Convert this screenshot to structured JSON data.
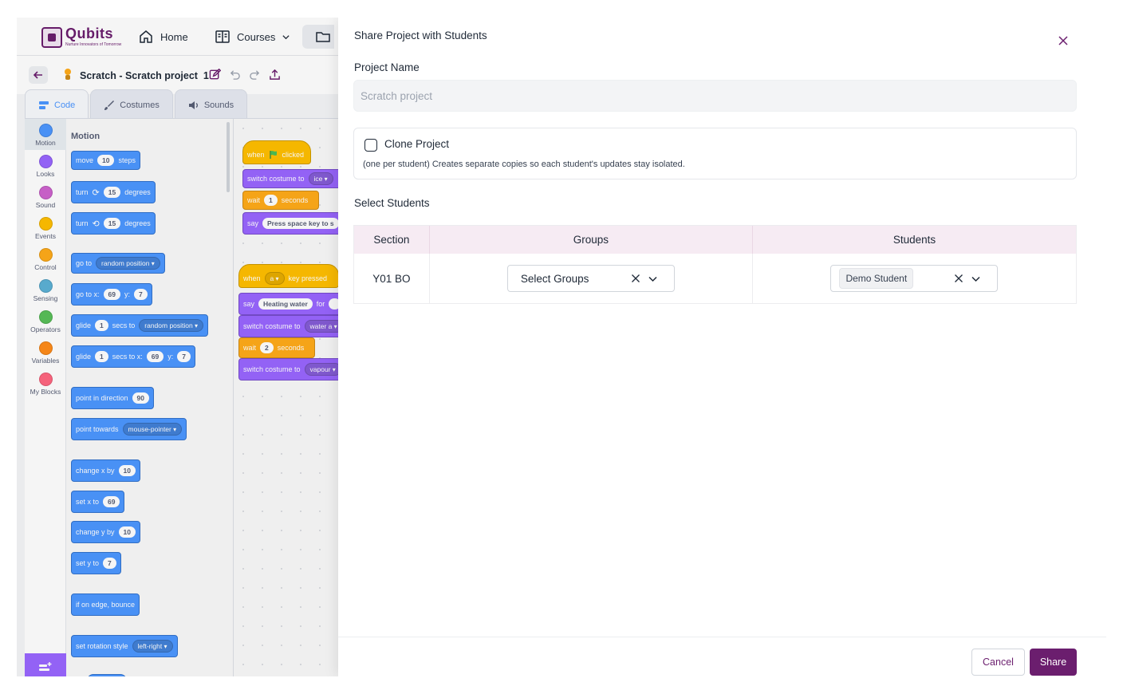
{
  "brand": {
    "name": "Qubits",
    "tagline": "Nurture Innovators of Tomorrow"
  },
  "nav": {
    "home": "Home",
    "courses": "Courses"
  },
  "project": {
    "title": "Scratch - Scratch project",
    "counter": "1"
  },
  "tabs": {
    "code": "Code",
    "costumes": "Costumes",
    "sounds": "Sounds"
  },
  "categories": [
    {
      "label": "Motion",
      "color": "#4c97ff"
    },
    {
      "label": "Looks",
      "color": "#9966ff"
    },
    {
      "label": "Sound",
      "color": "#cf63cf"
    },
    {
      "label": "Events",
      "color": "#ffbf00"
    },
    {
      "label": "Control",
      "color": "#ffab19"
    },
    {
      "label": "Sensing",
      "color": "#5cb1d6"
    },
    {
      "label": "Operators",
      "color": "#59c059"
    },
    {
      "label": "Variables",
      "color": "#ff8c1a"
    },
    {
      "label": "My Blocks",
      "color": "#ff6680"
    }
  ],
  "palette": {
    "title": "Motion",
    "move": {
      "a": "move",
      "n": "10",
      "b": "steps"
    },
    "turn_right": {
      "a": "turn",
      "n": "15",
      "b": "degrees"
    },
    "turn_left": {
      "a": "turn",
      "n": "15",
      "b": "degrees"
    },
    "goto": {
      "a": "go to",
      "dd": "random position"
    },
    "gotoxy": {
      "a": "go to x:",
      "x": "69",
      "b": "y:",
      "y": "7"
    },
    "glide": {
      "a": "glide",
      "n": "1",
      "b": "secs to",
      "dd": "random position"
    },
    "glidexy": {
      "a": "glide",
      "n": "1",
      "b": "secs to x:",
      "x": "69",
      "c": "y:",
      "y": "7"
    },
    "point_dir": {
      "a": "point in direction",
      "n": "90"
    },
    "point_towards": {
      "a": "point towards",
      "dd": "mouse-pointer"
    },
    "change_x": {
      "a": "change x by",
      "n": "10"
    },
    "set_x": {
      "a": "set x to",
      "n": "69"
    },
    "change_y": {
      "a": "change y by",
      "n": "10"
    },
    "set_y": {
      "a": "set y to",
      "n": "7"
    },
    "bounce": {
      "a": "if on edge, bounce"
    },
    "rotation": {
      "a": "set rotation style",
      "dd": "left-right"
    }
  },
  "script1": {
    "hat": {
      "a": "when",
      "b": "clicked"
    },
    "costume": {
      "a": "switch costume to",
      "dd": "ice"
    },
    "wait": {
      "a": "wait",
      "n": "1",
      "b": "seconds"
    },
    "say": {
      "a": "say",
      "text": "Press space key to s"
    }
  },
  "script2": {
    "hat": {
      "a": "when",
      "dd": "a",
      "b": "key pressed"
    },
    "say": {
      "a": "say",
      "text": "Heating water",
      "b": "for"
    },
    "costume1": {
      "a": "switch costume to",
      "dd": "water a"
    },
    "wait": {
      "a": "wait",
      "n": "2",
      "b": "seconds"
    },
    "costume2": {
      "a": "switch costume to",
      "dd": "vapour"
    }
  },
  "dialog": {
    "title": "Share Project with Students",
    "project_name_label": "Project Name",
    "project_name_placeholder": "Scratch project",
    "clone_label": "Clone Project",
    "clone_desc": "(one per student) Creates separate copies so each student's updates stay isolated.",
    "select_students_label": "Select Students",
    "table": {
      "headers": [
        "Section",
        "Groups",
        "Students"
      ],
      "rows": [
        {
          "section": "Y01 BO",
          "groups_placeholder": "Select Groups",
          "student_tag": "Demo Student"
        }
      ]
    },
    "cancel": "Cancel",
    "share": "Share"
  },
  "colors": {
    "brand": "#6b1e6e",
    "header_bg": "#f6ebf3"
  }
}
